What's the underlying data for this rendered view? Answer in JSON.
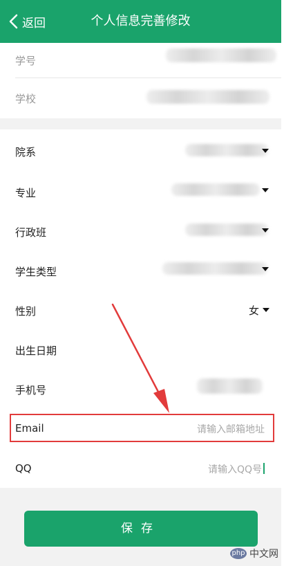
{
  "header": {
    "back_label": "返回",
    "title": "个人信息完善修改"
  },
  "fields": {
    "student_id": {
      "label": "学号"
    },
    "school": {
      "label": "学校"
    },
    "department": {
      "label": "院系"
    },
    "major": {
      "label": "专业"
    },
    "class": {
      "label": "行政班"
    },
    "student_type": {
      "label": "学生类型"
    },
    "gender": {
      "label": "性别",
      "value": "女"
    },
    "birth_date": {
      "label": "出生日期"
    },
    "phone": {
      "label": "手机号"
    },
    "email": {
      "label": "Email",
      "placeholder": "请输入邮箱地址"
    },
    "qq": {
      "label": "QQ",
      "placeholder": "请输入QQ号"
    }
  },
  "actions": {
    "save_label": "保存"
  },
  "colors": {
    "accent": "#1aa36b",
    "highlight": "#e23b3b"
  },
  "watermark": {
    "logo": "php",
    "text": "中文网"
  }
}
